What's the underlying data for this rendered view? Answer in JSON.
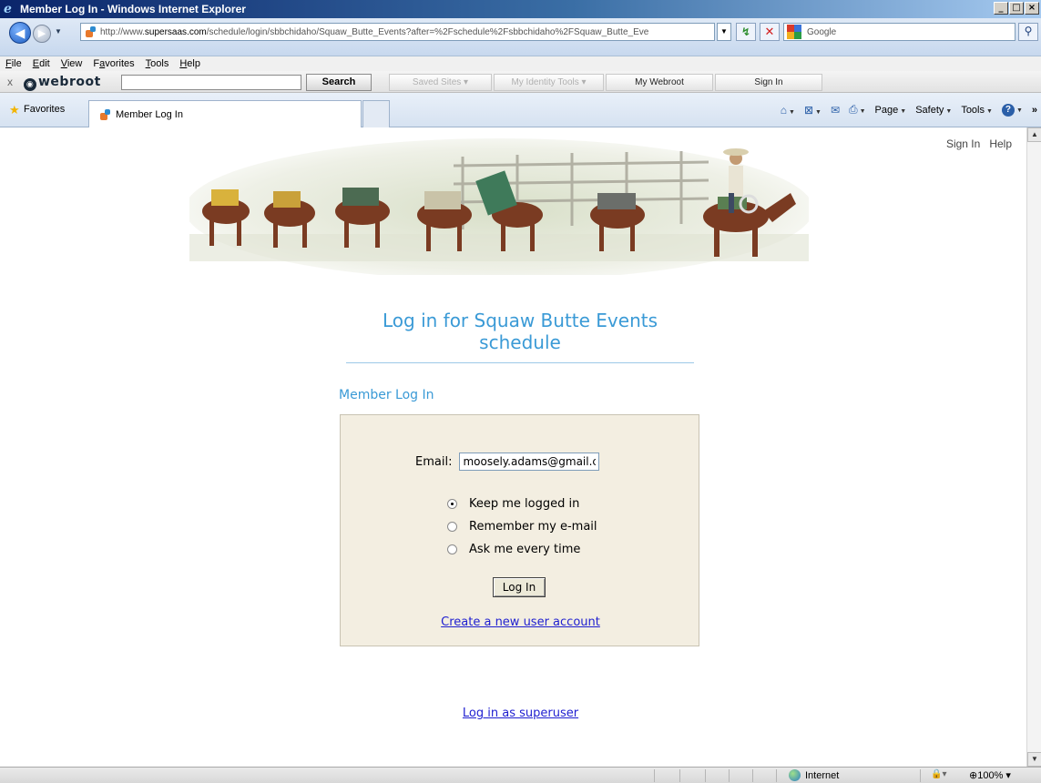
{
  "window": {
    "title": "Member Log In - Windows Internet Explorer"
  },
  "address_bar": {
    "url_prefix": "http://www.",
    "url_domain": "supersaas.com",
    "url_rest": "/schedule/login/sbbchidaho/Squaw_Butte_Events?after=%2Fschedule%2Fsbbchidaho%2FSquaw_Butte_Eve",
    "search_placeholder": "Google"
  },
  "menu": {
    "items": [
      {
        "label": "File",
        "accel": "F",
        "rest": "ile"
      },
      {
        "label": "Edit",
        "accel": "E",
        "rest": "dit"
      },
      {
        "label": "View",
        "accel": "V",
        "rest": "iew"
      },
      {
        "label": "Favorites",
        "accel": "a",
        "pre": "F",
        "rest": "vorites"
      },
      {
        "label": "Tools",
        "accel": "T",
        "rest": "ools"
      },
      {
        "label": "Help",
        "accel": "H",
        "rest": "elp"
      }
    ]
  },
  "webroot": {
    "close": "x",
    "logo": "webroot",
    "search_label": "Search",
    "saved_sites": "Saved Sites",
    "identity_tools": "My Identity Tools",
    "my_webroot": "My Webroot",
    "sign_in": "Sign In"
  },
  "favorites_bar": {
    "favorites_label": "Favorites",
    "tab_title": "Member Log In",
    "commands": {
      "page": "Page",
      "safety": "Safety",
      "tools": "Tools"
    }
  },
  "page": {
    "top_links": {
      "sign_in": "Sign In",
      "help": "Help"
    },
    "title": "Log in for Squaw Butte Events schedule",
    "section_title": "Member Log In",
    "form": {
      "email_label": "Email:",
      "email_value": "moosely.adams@gmail.com",
      "options": [
        {
          "label": "Keep me logged in",
          "selected": true
        },
        {
          "label": "Remember my e-mail",
          "selected": false
        },
        {
          "label": "Ask me every time",
          "selected": false
        }
      ],
      "submit_label": "Log In",
      "create_account": "Create a new user account"
    },
    "superuser_link": "Log in as superuser"
  },
  "status_bar": {
    "zone": "Internet",
    "zoom": "100%"
  },
  "colors": {
    "accent_blue": "#3a9ad6",
    "form_bg": "#f3eee1",
    "link": "#1f1fd0"
  }
}
